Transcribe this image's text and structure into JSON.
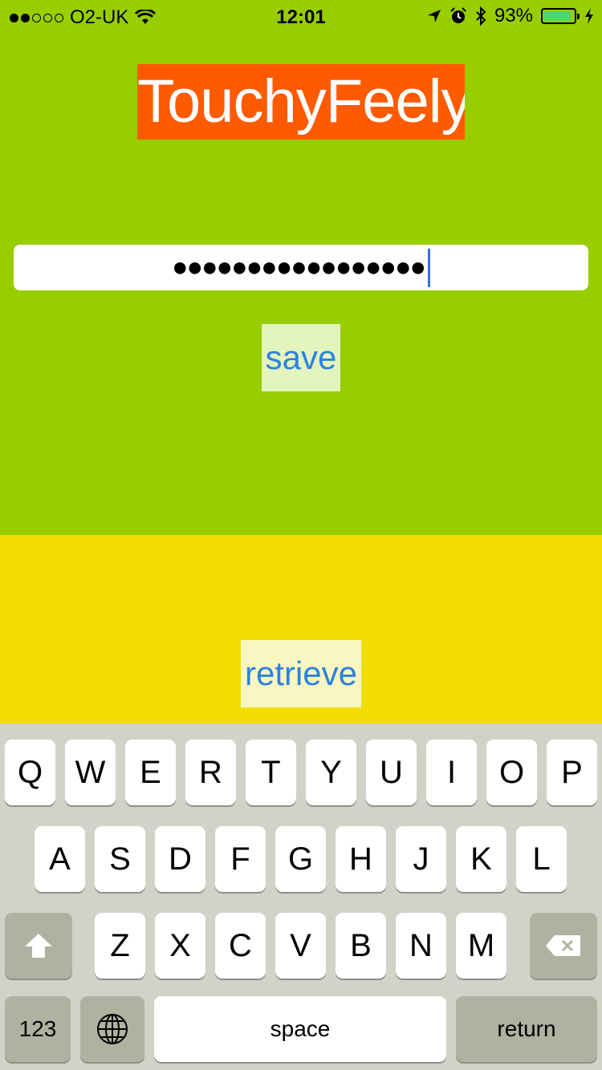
{
  "status_bar": {
    "carrier": "O2-UK",
    "time": "12:01",
    "battery_percent": "93%",
    "battery_level": 0.93,
    "signal_dots_filled": 2,
    "signal_dots_total": 5
  },
  "app": {
    "title": "TouchyFeely",
    "password_value": "●●●●●●●●●●●●●●●●●",
    "save_label": "save",
    "retrieve_label": "retrieve"
  },
  "keyboard": {
    "row1": [
      "Q",
      "W",
      "E",
      "R",
      "T",
      "Y",
      "U",
      "I",
      "O",
      "P"
    ],
    "row2": [
      "A",
      "S",
      "D",
      "F",
      "G",
      "H",
      "J",
      "K",
      "L"
    ],
    "row3": [
      "Z",
      "X",
      "C",
      "V",
      "B",
      "N",
      "M"
    ],
    "numbers_label": "123",
    "space_label": "space",
    "return_label": "return"
  },
  "colors": {
    "top_bg": "#98cd00",
    "title_bg": "#ff5a00",
    "bottom_bg": "#f2dd00",
    "button_text": "#2b82e0"
  }
}
